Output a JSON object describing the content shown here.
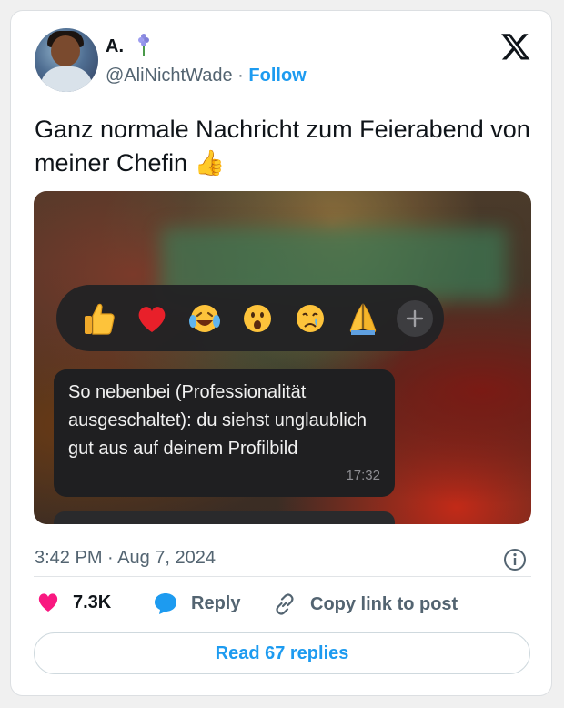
{
  "author": {
    "name": "A.",
    "name_emoji": "hyacinth-emoji",
    "handle": "@AliNichtWade",
    "separator": "·",
    "follow_label": "Follow"
  },
  "tweet": {
    "text": "Ganz normale Nachricht zum Feierabend von meiner Chefin 👍",
    "timestamp": "3:42 PM · Aug 7, 2024"
  },
  "screenshot": {
    "reactions": [
      "thumbs-up",
      "red-heart",
      "laughing-crying",
      "astonished",
      "crying",
      "folded-hands",
      "plus"
    ],
    "message": "So nebenbei (Professionalität ausgeschaltet): du siehst unglaublich gut aus auf deinem Profilbild",
    "message_time": "17:32"
  },
  "actions": {
    "likes": "7.3K",
    "reply": "Reply",
    "copy_link": "Copy link to post",
    "read_replies": "Read 67 replies"
  },
  "colors": {
    "accent": "#1d9bf0",
    "like": "#f91880",
    "muted": "#536471"
  }
}
